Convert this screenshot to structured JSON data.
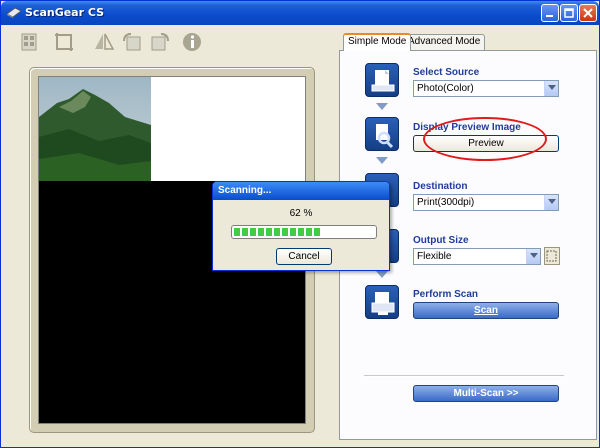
{
  "window": {
    "title": "ScanGear CS"
  },
  "toolbar": {
    "tools": [
      {
        "icon": "thumbnail-icon"
      },
      {
        "icon": "crop-icon"
      },
      {
        "icon": "mirror-icon"
      },
      {
        "icon": "rotate-left-icon"
      },
      {
        "icon": "rotate-right-icon"
      },
      {
        "icon": "info-icon"
      }
    ]
  },
  "tabs": [
    {
      "label": "Simple Mode",
      "active": true
    },
    {
      "label": "Advanced Mode",
      "active": false
    }
  ],
  "steps": {
    "select_source": {
      "label": "Select Source",
      "value": "Photo(Color)"
    },
    "display_preview": {
      "label": "Display Preview Image",
      "button": "Preview"
    },
    "destination": {
      "label": "Destination",
      "value": "Print(300dpi)"
    },
    "output_size": {
      "label": "Output Size",
      "value": "Flexible"
    },
    "perform_scan": {
      "label": "Perform Scan",
      "button": "Scan"
    }
  },
  "multi_scan_button": "Multi-Scan >>",
  "dialog": {
    "title": "Scanning...",
    "percent_text": "62 %",
    "progress": 0.62,
    "cancel_label": "Cancel"
  },
  "colors": {
    "titlebar": "#0a4ccc",
    "accent_label": "#1f3d99",
    "progress_fill": "#37d142",
    "highlight_ellipse": "#e11a1a"
  }
}
